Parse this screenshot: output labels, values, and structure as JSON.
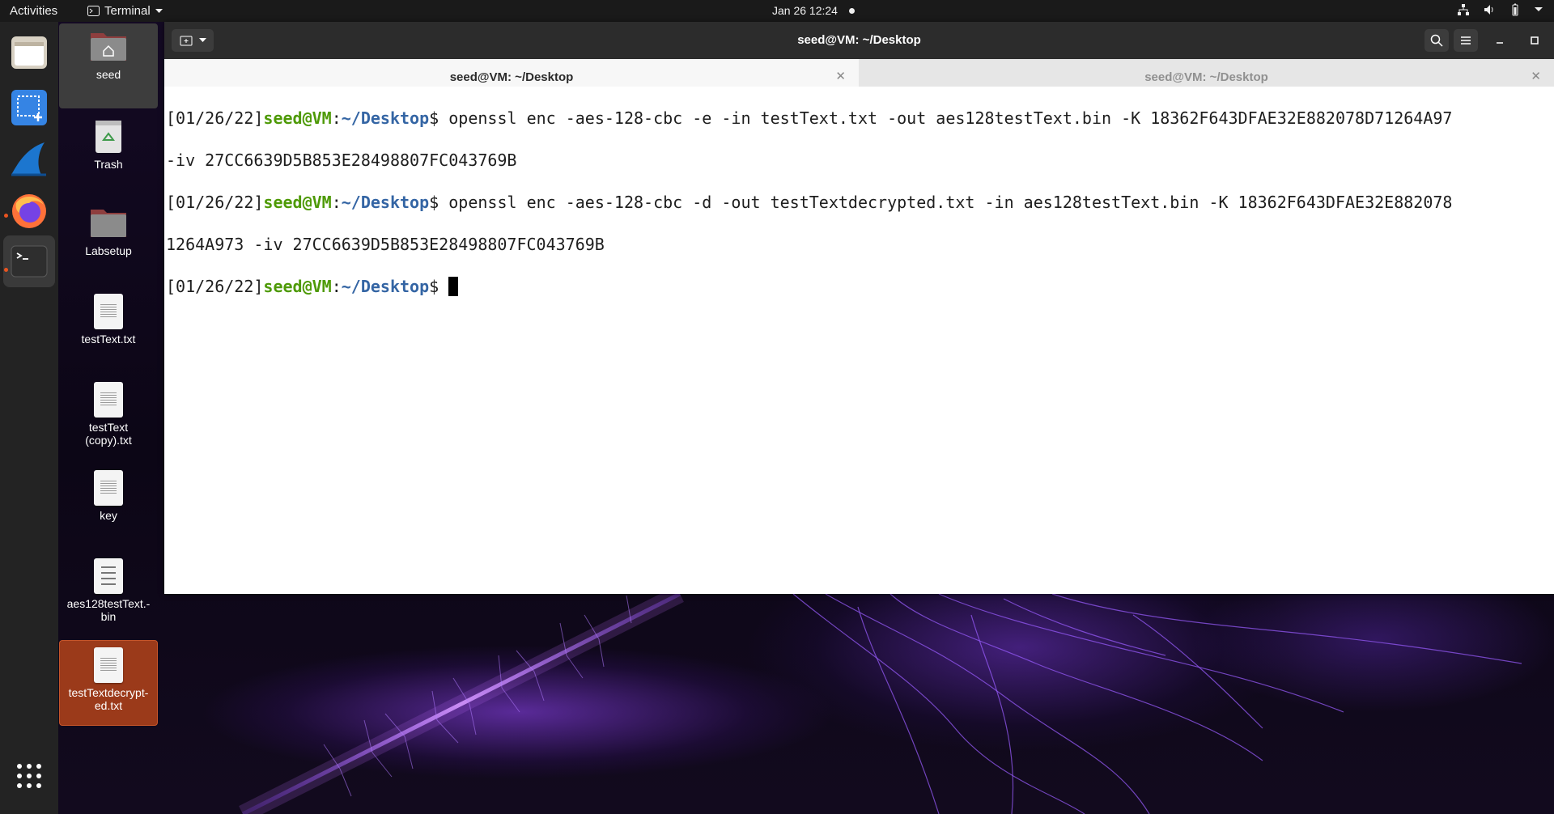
{
  "topbar": {
    "activities": "Activities",
    "app_name": "Terminal",
    "clock": "Jan 26  12:24"
  },
  "dock": {
    "items": [
      "files-icon",
      "screenshot-icon",
      "wireshark-icon",
      "firefox-icon",
      "terminal-icon",
      "show-apps-icon"
    ]
  },
  "desktop": {
    "icons": [
      {
        "label": "seed"
      },
      {
        "label": "Trash"
      },
      {
        "label": "Labsetup"
      },
      {
        "label": "testText.txt"
      },
      {
        "label": "testText (copy).txt"
      },
      {
        "label": "key"
      },
      {
        "label": "aes128testText.-bin"
      },
      {
        "label": "testTextdecrypt-ed.txt"
      }
    ]
  },
  "terminal": {
    "window_title": "seed@VM: ~/Desktop",
    "tabs": [
      {
        "label": "seed@VM: ~/Desktop",
        "active": true
      },
      {
        "label": "seed@VM: ~/Desktop",
        "active": false
      }
    ],
    "prompt": {
      "date": "[01/26/22]",
      "user": "seed@VM",
      "colon": ":",
      "path": "~/Desktop",
      "symbol": "$ "
    },
    "lines": {
      "cmd1": "openssl enc -aes-128-cbc -e -in testText.txt -out aes128testText.bin -K 18362F643DFAE32E882078D71264A97",
      "cmd1_wrap": "-iv 27CC6639D5B853E28498807FC043769B",
      "cmd2": "openssl enc -aes-128-cbc -d -out testTextdecrypted.txt -in aes128testText.bin -K 18362F643DFAE32E882078",
      "cmd2_wrap": "1264A973 -iv 27CC6639D5B853E28498807FC043769B"
    }
  },
  "colors": {
    "accent": "#e95420",
    "prompt_user": "#4e9a06",
    "prompt_path": "#3465a4",
    "selected_icon_bg": "#9b3a1a"
  }
}
